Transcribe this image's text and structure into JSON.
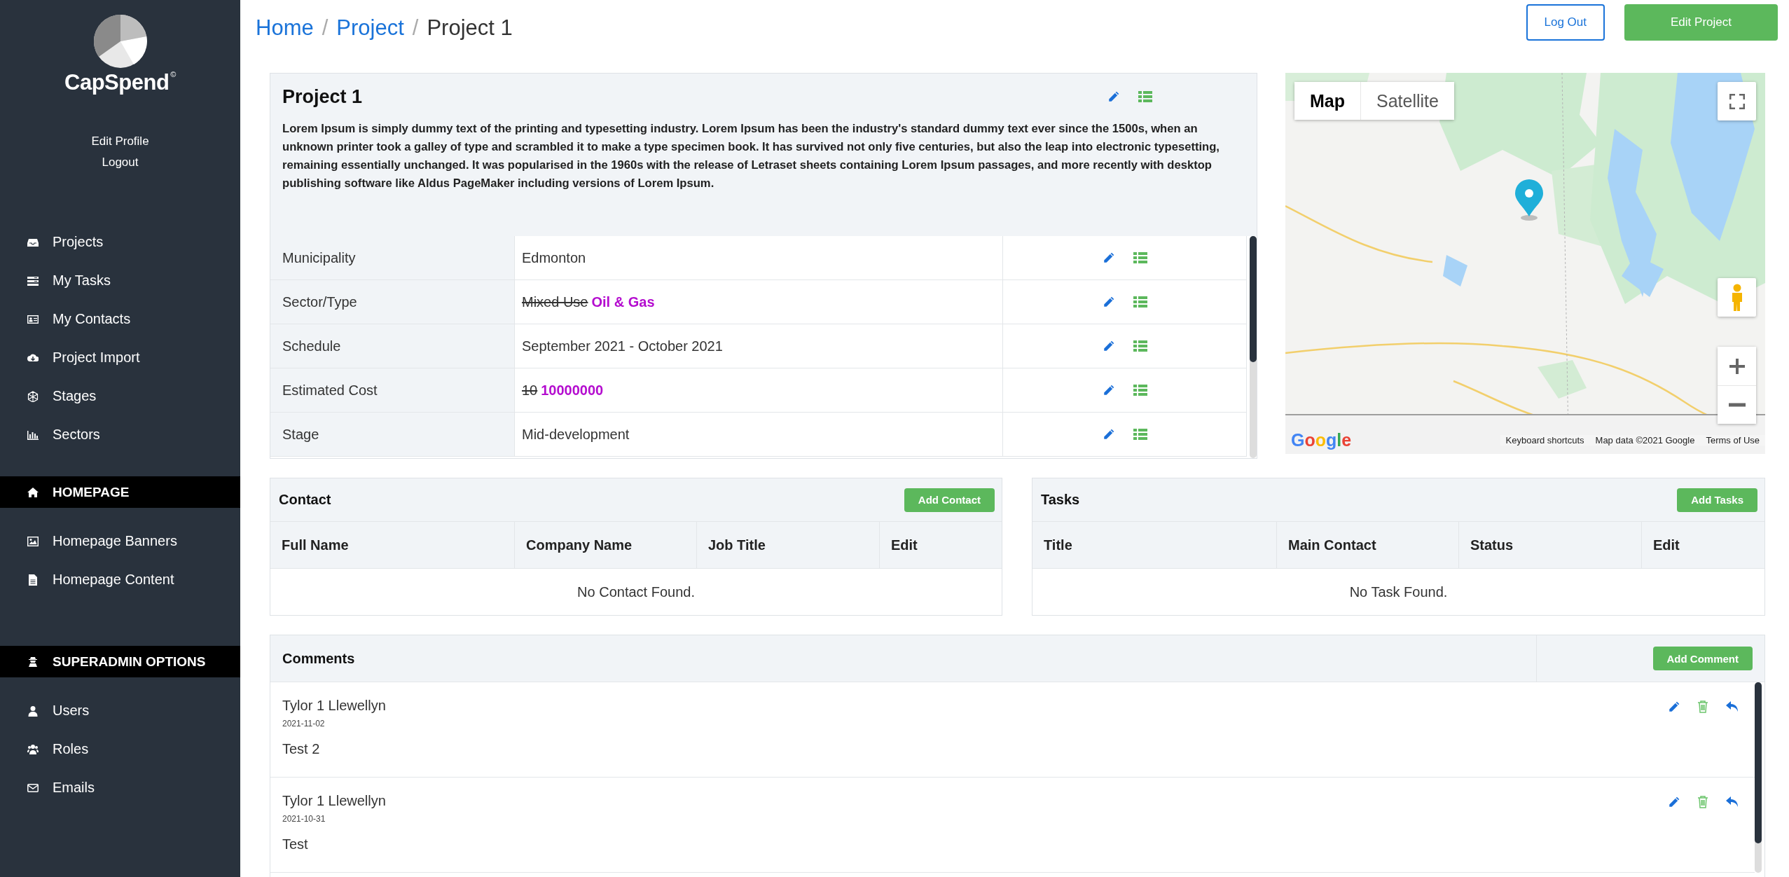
{
  "sidebar": {
    "logo_text": "CapSpend",
    "logo_mark": "©",
    "profile_links": [
      "Edit Profile",
      "Logout"
    ],
    "nav_items": [
      "Projects",
      "My Tasks",
      "My Contacts",
      "Project Import",
      "Stages",
      "Sectors"
    ],
    "groups": [
      {
        "heading": "HOMEPAGE",
        "items": [
          "Homepage Banners",
          "Homepage Content"
        ]
      },
      {
        "heading": "SUPERADMIN OPTIONS",
        "items": [
          "Users",
          "Roles",
          "Emails"
        ]
      }
    ]
  },
  "breadcrumb_separator": "/",
  "breadcrumb": [
    {
      "label": "Home",
      "link": true
    },
    {
      "label": "Project",
      "link": true
    },
    {
      "label": "Project 1",
      "link": false
    }
  ],
  "header_buttons": [
    {
      "label": "Log Out",
      "kind": "outline"
    },
    {
      "label": "Edit Project",
      "kind": "primary"
    }
  ],
  "project": {
    "title": "Project 1",
    "description": "**Lorem Ipsum** is simply dummy text of the printing and typesetting industry. Lorem Ipsum has been the industry's standard dummy text ever since the 1500s, when an unknown printer took a galley of type and scrambled it to make a type specimen book. It has survived not only five centuries, but also the leap into electronic typesetting, remaining essentially unchanged. It was popularised in the 1960s with the release of Letraset sheets containing Lorem Ipsum passages, and more recently with desktop publishing software like Aldus PageMaker including versions of Lorem Ipsum.",
    "details": [
      {
        "label": "Municipality",
        "kind": "plain",
        "value": "Edmonton"
      },
      {
        "label": "Sector/Type",
        "kind": "changed",
        "old_value": "Mixed Use",
        "new_value": "Oil & Gas"
      },
      {
        "label": "Schedule",
        "kind": "plain",
        "value": "September 2021 - October 2021"
      },
      {
        "label": "Estimated Cost",
        "kind": "changed",
        "old_value": "10",
        "new_value": "10000000"
      },
      {
        "label": "Stage",
        "kind": "plain",
        "value": "Mid-development"
      }
    ]
  },
  "map": {
    "map_types": [
      {
        "label": "Map",
        "selected": true
      },
      {
        "label": "Satellite",
        "selected": false
      }
    ],
    "logo": "Google",
    "footer": [
      "Keyboard shortcuts",
      "Map data ©2021 Google",
      "Terms of Use"
    ]
  },
  "contacts": {
    "title": "Contact",
    "add_button": "Add Contact",
    "columns": [
      "Full Name",
      "Company Name",
      "Job Title",
      "Edit"
    ],
    "empty_message": "No Contact Found."
  },
  "tasks": {
    "title": "Tasks",
    "add_button": "Add Tasks",
    "columns": [
      "Title",
      "Main Contact",
      "Status",
      "Edit"
    ],
    "empty_message": "No Task Found."
  },
  "comments": {
    "title": "Comments",
    "add_button": "Add Comment",
    "items": [
      {
        "author": "Tylor 1 Llewellyn",
        "date": "2021-11-02",
        "text": "Test 2"
      },
      {
        "author": "Tylor 1 Llewellyn",
        "date": "2021-10-31",
        "text": "Test"
      }
    ]
  }
}
